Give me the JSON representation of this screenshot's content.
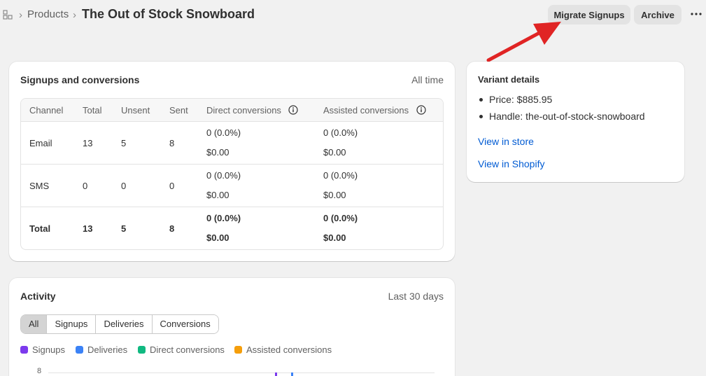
{
  "header": {
    "home_icon": "store-icon",
    "breadcrumb_separator": "›",
    "breadcrumb_parent": "Products",
    "title": "The Out of Stock Snowboard",
    "migrate_button": "Migrate Signups",
    "archive_button": "Archive",
    "more_icon": "more-horizontal-icon"
  },
  "signups": {
    "title": "Signups and conversions",
    "range": "All time",
    "columns": [
      "Channel",
      "Total",
      "Unsent",
      "Sent",
      "Direct conversions",
      "Assisted conversions"
    ],
    "rows": [
      {
        "channel": "Email",
        "total": "13",
        "unsent": "5",
        "sent": "8",
        "direct_count": "0 (0.0%)",
        "direct_value": "$0.00",
        "assisted_count": "0 (0.0%)",
        "assisted_value": "$0.00"
      },
      {
        "channel": "SMS",
        "total": "0",
        "unsent": "0",
        "sent": "0",
        "direct_count": "0 (0.0%)",
        "direct_value": "$0.00",
        "assisted_count": "0 (0.0%)",
        "assisted_value": "$0.00"
      },
      {
        "channel": "Total",
        "total": "13",
        "unsent": "5",
        "sent": "8",
        "direct_count": "0 (0.0%)",
        "direct_value": "$0.00",
        "assisted_count": "0 (0.0%)",
        "assisted_value": "$0.00"
      }
    ]
  },
  "variant": {
    "title": "Variant details",
    "items": [
      "Price: $885.95",
      "Handle: the-out-of-stock-snowboard"
    ],
    "link_store": "View in store",
    "link_shopify": "View in Shopify"
  },
  "activity": {
    "title": "Activity",
    "range": "Last 30 days",
    "tabs": [
      "All",
      "Signups",
      "Deliveries",
      "Conversions"
    ],
    "active_tab": "All",
    "legend": [
      {
        "label": "Signups",
        "color": "#7c3aed"
      },
      {
        "label": "Deliveries",
        "color": "#3b82f6"
      },
      {
        "label": "Direct conversions",
        "color": "#10b981"
      },
      {
        "label": "Assisted conversions",
        "color": "#f59e0b"
      }
    ],
    "y_tick_top": "8"
  },
  "colors": {
    "annotation_arrow": "#e02424",
    "link": "#005bd3"
  }
}
